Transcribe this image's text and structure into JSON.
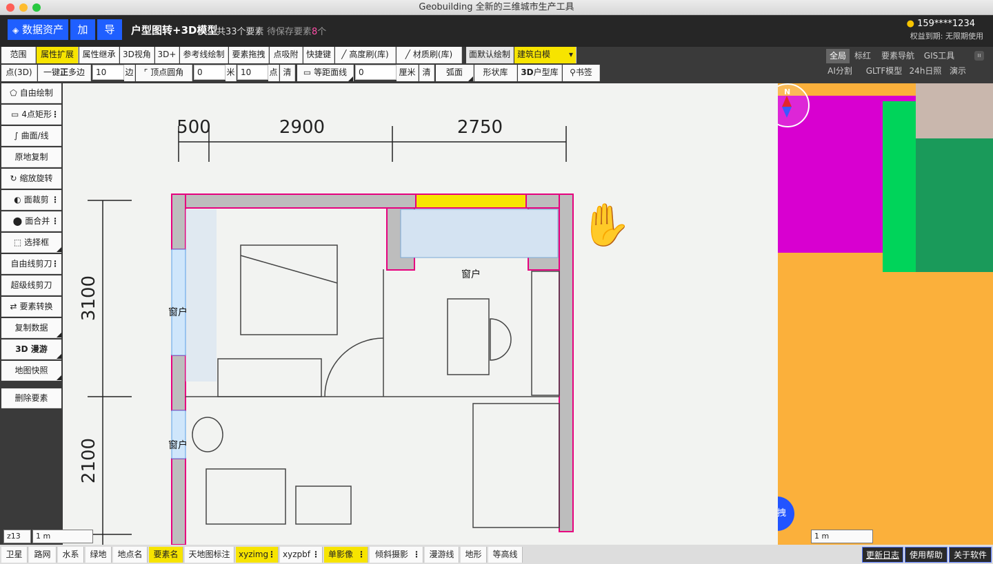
{
  "window": {
    "title": "Geobuilding 全新的三维城市生产工具"
  },
  "header": {
    "assets_label": "数据资产",
    "add_label": "加",
    "import_label": "导",
    "title": "户型图转+3D模型",
    "count_text": "共33个要素",
    "pending_prefix": "待保存要素",
    "pending_count": "8",
    "pending_suffix": "个",
    "user_id": "159****1234",
    "rights": "权益到期: 无限期使用"
  },
  "toolbar1": {
    "items": [
      "范围",
      "属性扩展",
      "属性继承",
      "3D视角",
      "3D+",
      "参考线绘制",
      "要素拖拽",
      "点吸附",
      "快捷键",
      "高度刷(库)",
      "材质刷(库)",
      "面默认绘制",
      "建筑白模"
    ]
  },
  "toolbar2": {
    "point3d": "点(3D)",
    "one_key": "一键",
    "zheng": "正",
    "polygon": "多边",
    "sides_value": "10",
    "sides_unit": "边",
    "corner": "顶点圆角",
    "corner_value": "0",
    "corner_unit": "米",
    "point_value": "10",
    "point_unit": "点",
    "clear1": "清",
    "equidistant": "等距面线",
    "equi_value": "0",
    "equi_unit": "厘米",
    "clear2": "清",
    "arc": "弧面",
    "shape_lib": "形状库",
    "house_lib_3d": "3D",
    "house_lib": "户型库",
    "bookmark": "书签"
  },
  "right_panel": {
    "row1": [
      "全局",
      "标红",
      "要素导航",
      "GIS工具"
    ],
    "row2": [
      "AI分割",
      "GLTF模型",
      "24h日照",
      "演示"
    ]
  },
  "left_tools": [
    "自由绘制",
    "4点矩形",
    "曲面/线",
    "原地复制",
    "缩放旋转",
    "面裁剪",
    "面合并",
    "选择框",
    "自由线剪刀",
    "超级线剪刀",
    "要素转换",
    "复制数据",
    "3D 漫游",
    "地图快照",
    "删除要素"
  ],
  "floorplan": {
    "dims_top": [
      "500",
      "2900",
      "2750"
    ],
    "dims_left": [
      "3100",
      "2100"
    ],
    "window_labels": [
      "窗户",
      "窗户",
      "窗户"
    ]
  },
  "map3d": {
    "compass": "N",
    "drag_button": "拖拽",
    "scale": "1 m"
  },
  "status": {
    "zoom": "z13",
    "scale": "1 m"
  },
  "bottom": {
    "layers": [
      "卫星",
      "路网",
      "水系",
      "绿地",
      "地点名",
      "要素名",
      "天地图标注",
      "xyzimg",
      "xyzpbf",
      "单影像",
      "倾斜摄影",
      "漫游线",
      "地形",
      "等高线"
    ],
    "links": [
      "更新日志",
      "使用帮助",
      "关于软件"
    ]
  },
  "colors": {
    "accent": "#1f5fff",
    "highlight": "#f7e400",
    "pink": "#e6007e"
  }
}
